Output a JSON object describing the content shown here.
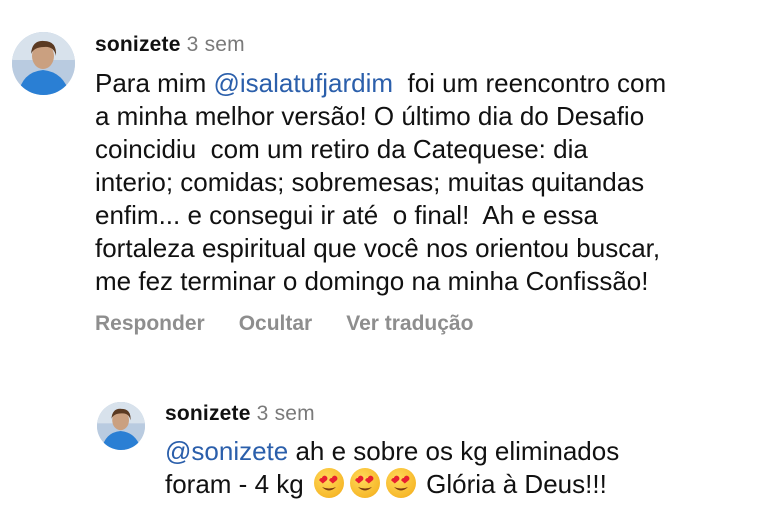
{
  "comment": {
    "username": "sonizete",
    "time": "3 sem",
    "mention": "@isalatufjardim",
    "lines": [
      "  foi um reencontro com",
      "a minha melhor versão! O último dia do Desafio",
      "coincidiu  com um retiro da Catequese: dia",
      "interio; comidas; sobremesas; muitas quitandas",
      "enfim... e consegui ir até  o final!  Ah e essa",
      "fortaleza espiritual que você nos orientou buscar,",
      "me fez terminar o domingo na minha Confissão!"
    ],
    "prefix": "Para mim "
  },
  "actions": {
    "reply": "Responder",
    "hide": "Ocultar",
    "translate": "Ver tradução"
  },
  "reply": {
    "username": "sonizete",
    "time": "3 sem",
    "mention": "@sonizete",
    "line1_rest": " ah e sobre os kg eliminados",
    "line2_start": "foram - 4 kg ",
    "line2_end": " Glória à Deus!!!",
    "emoji": "smiling-face-with-heart-eyes"
  },
  "colors": {
    "mention": "#2b5fab",
    "secondary": "#8e8e8e"
  }
}
